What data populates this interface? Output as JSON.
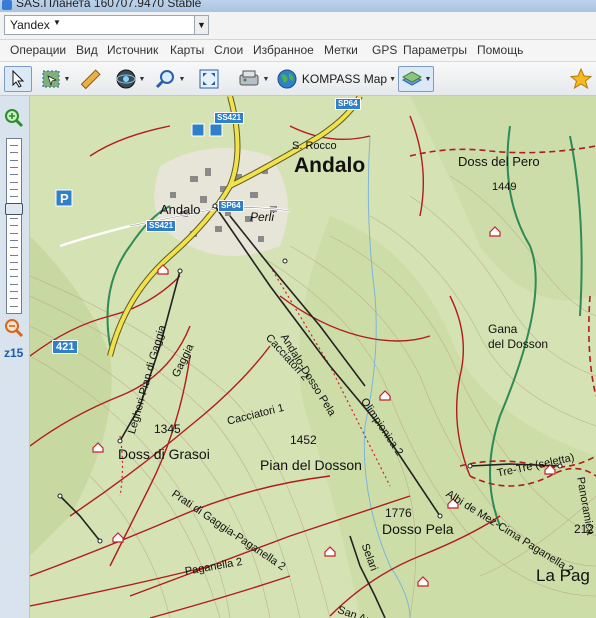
{
  "window": {
    "title": "SAS.Планета 160707.9470 Stable"
  },
  "address": {
    "map_value": "Yandex"
  },
  "menu": {
    "items": [
      "Операции",
      "Вид",
      "Источник",
      "Карты",
      "Слои",
      "Избранное",
      "Метки",
      "GPS",
      "Параметры",
      "Помощь"
    ]
  },
  "toolbar": {
    "map_label": "KOMPASS Map"
  },
  "sidebar": {
    "zoom_label": "z15"
  },
  "map": {
    "labels": {
      "andalo_big": "Andalo",
      "andalo_small": "Andalo",
      "s_rocco": "S. Rocco",
      "perli": "Perli",
      "doss_del_pero": "Doss del Pero",
      "h1449": "1449",
      "gana_del_dosson": "Gana\ndel Dosson",
      "h1345": "1345",
      "doss_di_grasoi": "Doss di Grasoi",
      "h1452": "1452",
      "pian_del_dosson": "Pian del Dosson",
      "h1776": "1776",
      "dosso_pela": "Dosso Pela",
      "la_paga": "La Pag",
      "h212": "212",
      "cacciatori2": "Cacciatori 2",
      "cacciatori1": "Cacciatori 1",
      "andalo_dosso_pela": "Andalo-Dosso Pela",
      "olimpionica": "Olimpionica 2",
      "gaggia": "Gaggia",
      "legheri": "Legheri-Pian di Gaggia",
      "prati": "Prati di Gaggia-Paganella 2",
      "paganella2": "Paganella 2",
      "albi": "Albi de Mez-Cima Paganella 2",
      "tre_tre": "Tre-Tre (seletta)",
      "selari": "Selari",
      "san_an": "San An",
      "panoramica": "Panoramica"
    },
    "shields": {
      "sp64_top": "SP64",
      "ss421_top": "SS421",
      "sp64_mid": "SP64",
      "ss421_mid": "SS421",
      "r421": "421"
    }
  }
}
